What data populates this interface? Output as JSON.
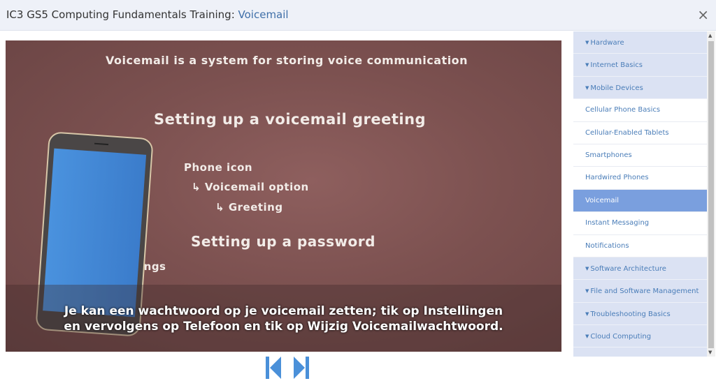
{
  "header": {
    "title_prefix": "IC3 GS5 Computing Fundamentals Training: ",
    "title_accent": "Voicemail",
    "close": "×"
  },
  "video": {
    "heading": "Voicemail is a system for storing voice communication",
    "step1": "Setting up a voicemail greeting",
    "phone_icon": "Phone icon",
    "voicemail_option": "Voicemail option",
    "greeting": "Greeting",
    "step2": "Setting up a password",
    "settings_partial": "ings",
    "subtitle_line1": "Je kan een wachtwoord op je voicemail zetten; tik op Instellingen",
    "subtitle_line2": "en vervolgens op Telefoon en tik op Wijzig Voicemailwachtwoord.",
    "arrow": "↳"
  },
  "nav": {
    "prev_icon": "skip-back-icon",
    "next_icon": "skip-forward-icon",
    "color": "#4a90d9"
  },
  "sidebar": {
    "items": [
      {
        "label": "Hardware",
        "type": "section"
      },
      {
        "label": "Internet Basics",
        "type": "section"
      },
      {
        "label": "Mobile Devices",
        "type": "section"
      },
      {
        "label": "Cellular Phone Basics",
        "type": "lesson"
      },
      {
        "label": "Cellular-Enabled Tablets",
        "type": "lesson"
      },
      {
        "label": "Smartphones",
        "type": "lesson"
      },
      {
        "label": "Hardwired Phones",
        "type": "lesson"
      },
      {
        "label": "Voicemail",
        "type": "active"
      },
      {
        "label": "Instant Messaging",
        "type": "lesson"
      },
      {
        "label": "Notifications",
        "type": "lesson"
      },
      {
        "label": "Software Architecture",
        "type": "section"
      },
      {
        "label": "File and Software Management",
        "type": "section"
      },
      {
        "label": "Troubleshooting Basics",
        "type": "section"
      },
      {
        "label": "Cloud Computing",
        "type": "section"
      },
      {
        "label": "",
        "type": "section"
      }
    ],
    "triangle": "▼"
  }
}
